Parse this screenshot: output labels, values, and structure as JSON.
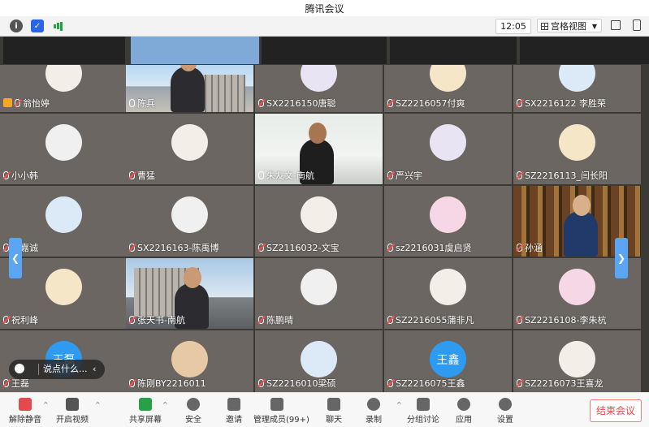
{
  "window": {
    "title": "腾讯会议"
  },
  "toolbar": {
    "time": "12:05",
    "view_label": "宫格视图"
  },
  "tiles": [
    {
      "name": "翁怡婷",
      "muted": true,
      "host": true
    },
    {
      "name": "陈兵",
      "muted": false
    },
    {
      "name": "SX2216150唐聪",
      "muted": true
    },
    {
      "name": "SZ2216057付爽",
      "muted": true
    },
    {
      "name": "SX2216122 李胜荣",
      "muted": true
    },
    {
      "name": "小小韩",
      "muted": true
    },
    {
      "name": "曹猛",
      "muted": true
    },
    {
      "name": "朱友文-南航",
      "muted": false
    },
    {
      "name": "严兴宇",
      "muted": true
    },
    {
      "name": "SZ2216113_闫长阳",
      "muted": true
    },
    {
      "name": "燕嘉诚",
      "muted": true
    },
    {
      "name": "SX2216163-陈禹博",
      "muted": true
    },
    {
      "name": "SZ2116032-文宝",
      "muted": true
    },
    {
      "name": "sz2216031虞启贤",
      "muted": true
    },
    {
      "name": "孙涵",
      "muted": true
    },
    {
      "name": "祝利峰",
      "muted": true
    },
    {
      "name": "张天书-南航",
      "muted": true
    },
    {
      "name": "陈鹏晴",
      "muted": true
    },
    {
      "name": "SZ2216055蒲非凡",
      "muted": true
    },
    {
      "name": "SZ2216108-李朱杭",
      "muted": true
    },
    {
      "name": "王磊",
      "muted": true,
      "avatar_text": "王磊"
    },
    {
      "name": "陈刚BY2216011",
      "muted": true
    },
    {
      "name": "SZ2216010梁硕",
      "muted": true
    },
    {
      "name": "SZ2216075王鑫",
      "muted": true,
      "avatar_text": "王鑫"
    },
    {
      "name": "SZ2216073王喜龙",
      "muted": true
    }
  ],
  "chat": {
    "placeholder": "说点什么..."
  },
  "bottombar": {
    "items": [
      "解除静音",
      "开启视频",
      "共享屏幕",
      "安全",
      "邀请",
      "管理成员(99+)",
      "聊天",
      "录制",
      "分组讨论",
      "应用",
      "设置"
    ],
    "end_label": "结束会议"
  },
  "colors": {
    "accent": "#2e9bf0",
    "end": "#e5484d",
    "active_speaker": "#3fc96d"
  }
}
